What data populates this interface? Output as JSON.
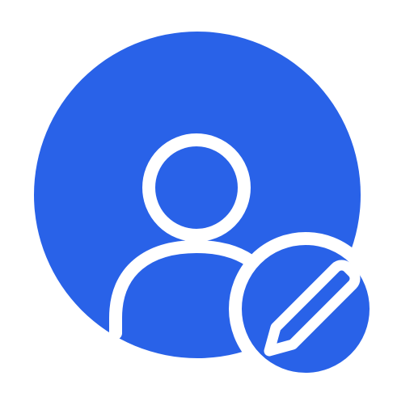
{
  "icon": {
    "name": "edit-user-profile-icon",
    "parts": [
      "user-circle-icon",
      "user-head-icon",
      "user-shoulders-icon",
      "edit-badge-icon",
      "pencil-icon"
    ]
  },
  "colors": {
    "primary": "#2962E8",
    "stroke": "#FFFFFF",
    "background": "#FFFFFF"
  }
}
